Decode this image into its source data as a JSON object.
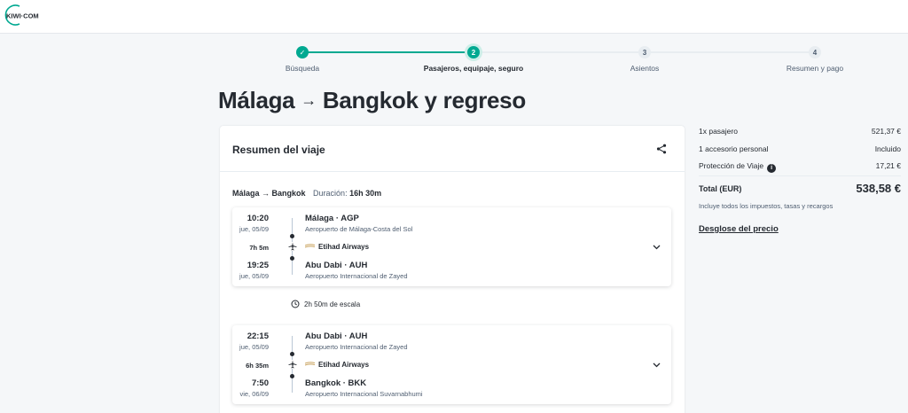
{
  "brand": {
    "logo_text": "KIWI·COM",
    "accent_color": "#00a991"
  },
  "stepper": {
    "steps": [
      {
        "number": "✓",
        "label": "Búsqueda",
        "state": "done"
      },
      {
        "number": "2",
        "label": "Pasajeros, equipaje, seguro",
        "state": "active"
      },
      {
        "number": "3",
        "label": "Asientos",
        "state": "todo"
      },
      {
        "number": "4",
        "label": "Resumen y pago",
        "state": "todo"
      }
    ]
  },
  "page": {
    "origin": "Málaga",
    "arrow": "→",
    "destination": "Bangkok y regreso"
  },
  "trip": {
    "header": "Resumen del viaje",
    "share_icon": "share-icon",
    "route_title": "Málaga → Bangkok",
    "duration_label": "Duración:",
    "duration_value": "16h 30m",
    "segments": [
      {
        "dep_time": "10:20",
        "dep_date": "jue, 05/09",
        "dep_place": "Málaga · AGP",
        "dep_airport": "Aeropuerto de Málaga-Costa del Sol",
        "flight_length": "7h 5m",
        "airline": "Etihad Airways",
        "arr_time": "19:25",
        "arr_date": "jue, 05/09",
        "arr_place": "Abu Dabi · AUH",
        "arr_airport": "Aeropuerto Internacional de Zayed"
      },
      {
        "dep_time": "22:15",
        "dep_date": "jue, 05/09",
        "dep_place": "Abu Dabi · AUH",
        "dep_airport": "Aeropuerto Internacional de Zayed",
        "flight_length": "6h 35m",
        "airline": "Etihad Airways",
        "arr_time": "7:50",
        "arr_date": "vie, 06/09",
        "arr_place": "Bangkok · BKK",
        "arr_airport": "Aeropuerto Internacional Suvarnabhumi"
      }
    ],
    "layover": "2h 50m de escala"
  },
  "price": {
    "rows": [
      {
        "label": "1x pasajero",
        "value": "521,37 €"
      },
      {
        "label": "1 accesorio personal",
        "value": "Incluido"
      },
      {
        "label": "Protección de Viaje",
        "value": "17,21 €",
        "info_icon": "i"
      }
    ],
    "total_label": "Total (EUR)",
    "total_value": "538,58 €",
    "taxes_note": "Incluye todos los impuestos, tasas y recargos",
    "breakdown_link": "Desglose del precio"
  }
}
